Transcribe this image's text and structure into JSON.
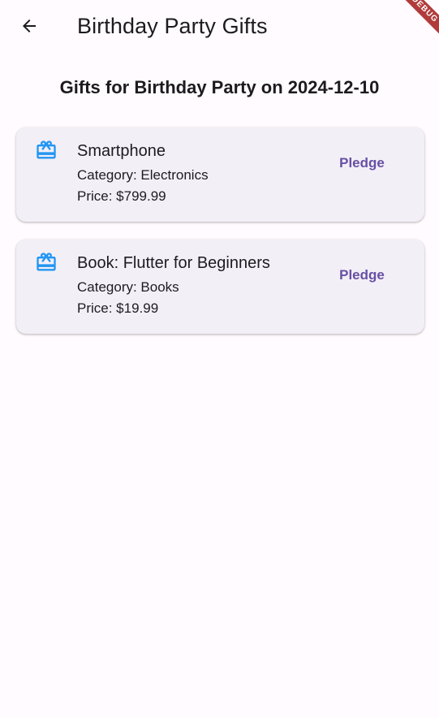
{
  "appbar": {
    "title": "Birthday Party Gifts",
    "back_icon": "arrow-back-icon"
  },
  "debug_banner": {
    "label": "DEBUG",
    "color": "#b13b3b"
  },
  "page": {
    "heading": "Gifts for Birthday Party on 2024-12-10"
  },
  "theme": {
    "background": "#fffbfe",
    "card_background": "#f3eff7",
    "accent": "#6750a4",
    "icon_color": "#2196f3"
  },
  "gifts": [
    {
      "icon": "gift-card-icon",
      "name": "Smartphone",
      "category": "Category: Electronics",
      "price": "Price: $799.99",
      "action_label": "Pledge"
    },
    {
      "icon": "gift-card-icon",
      "name": "Book: Flutter for Beginners",
      "category": "Category: Books",
      "price": "Price: $19.99",
      "action_label": "Pledge"
    }
  ]
}
